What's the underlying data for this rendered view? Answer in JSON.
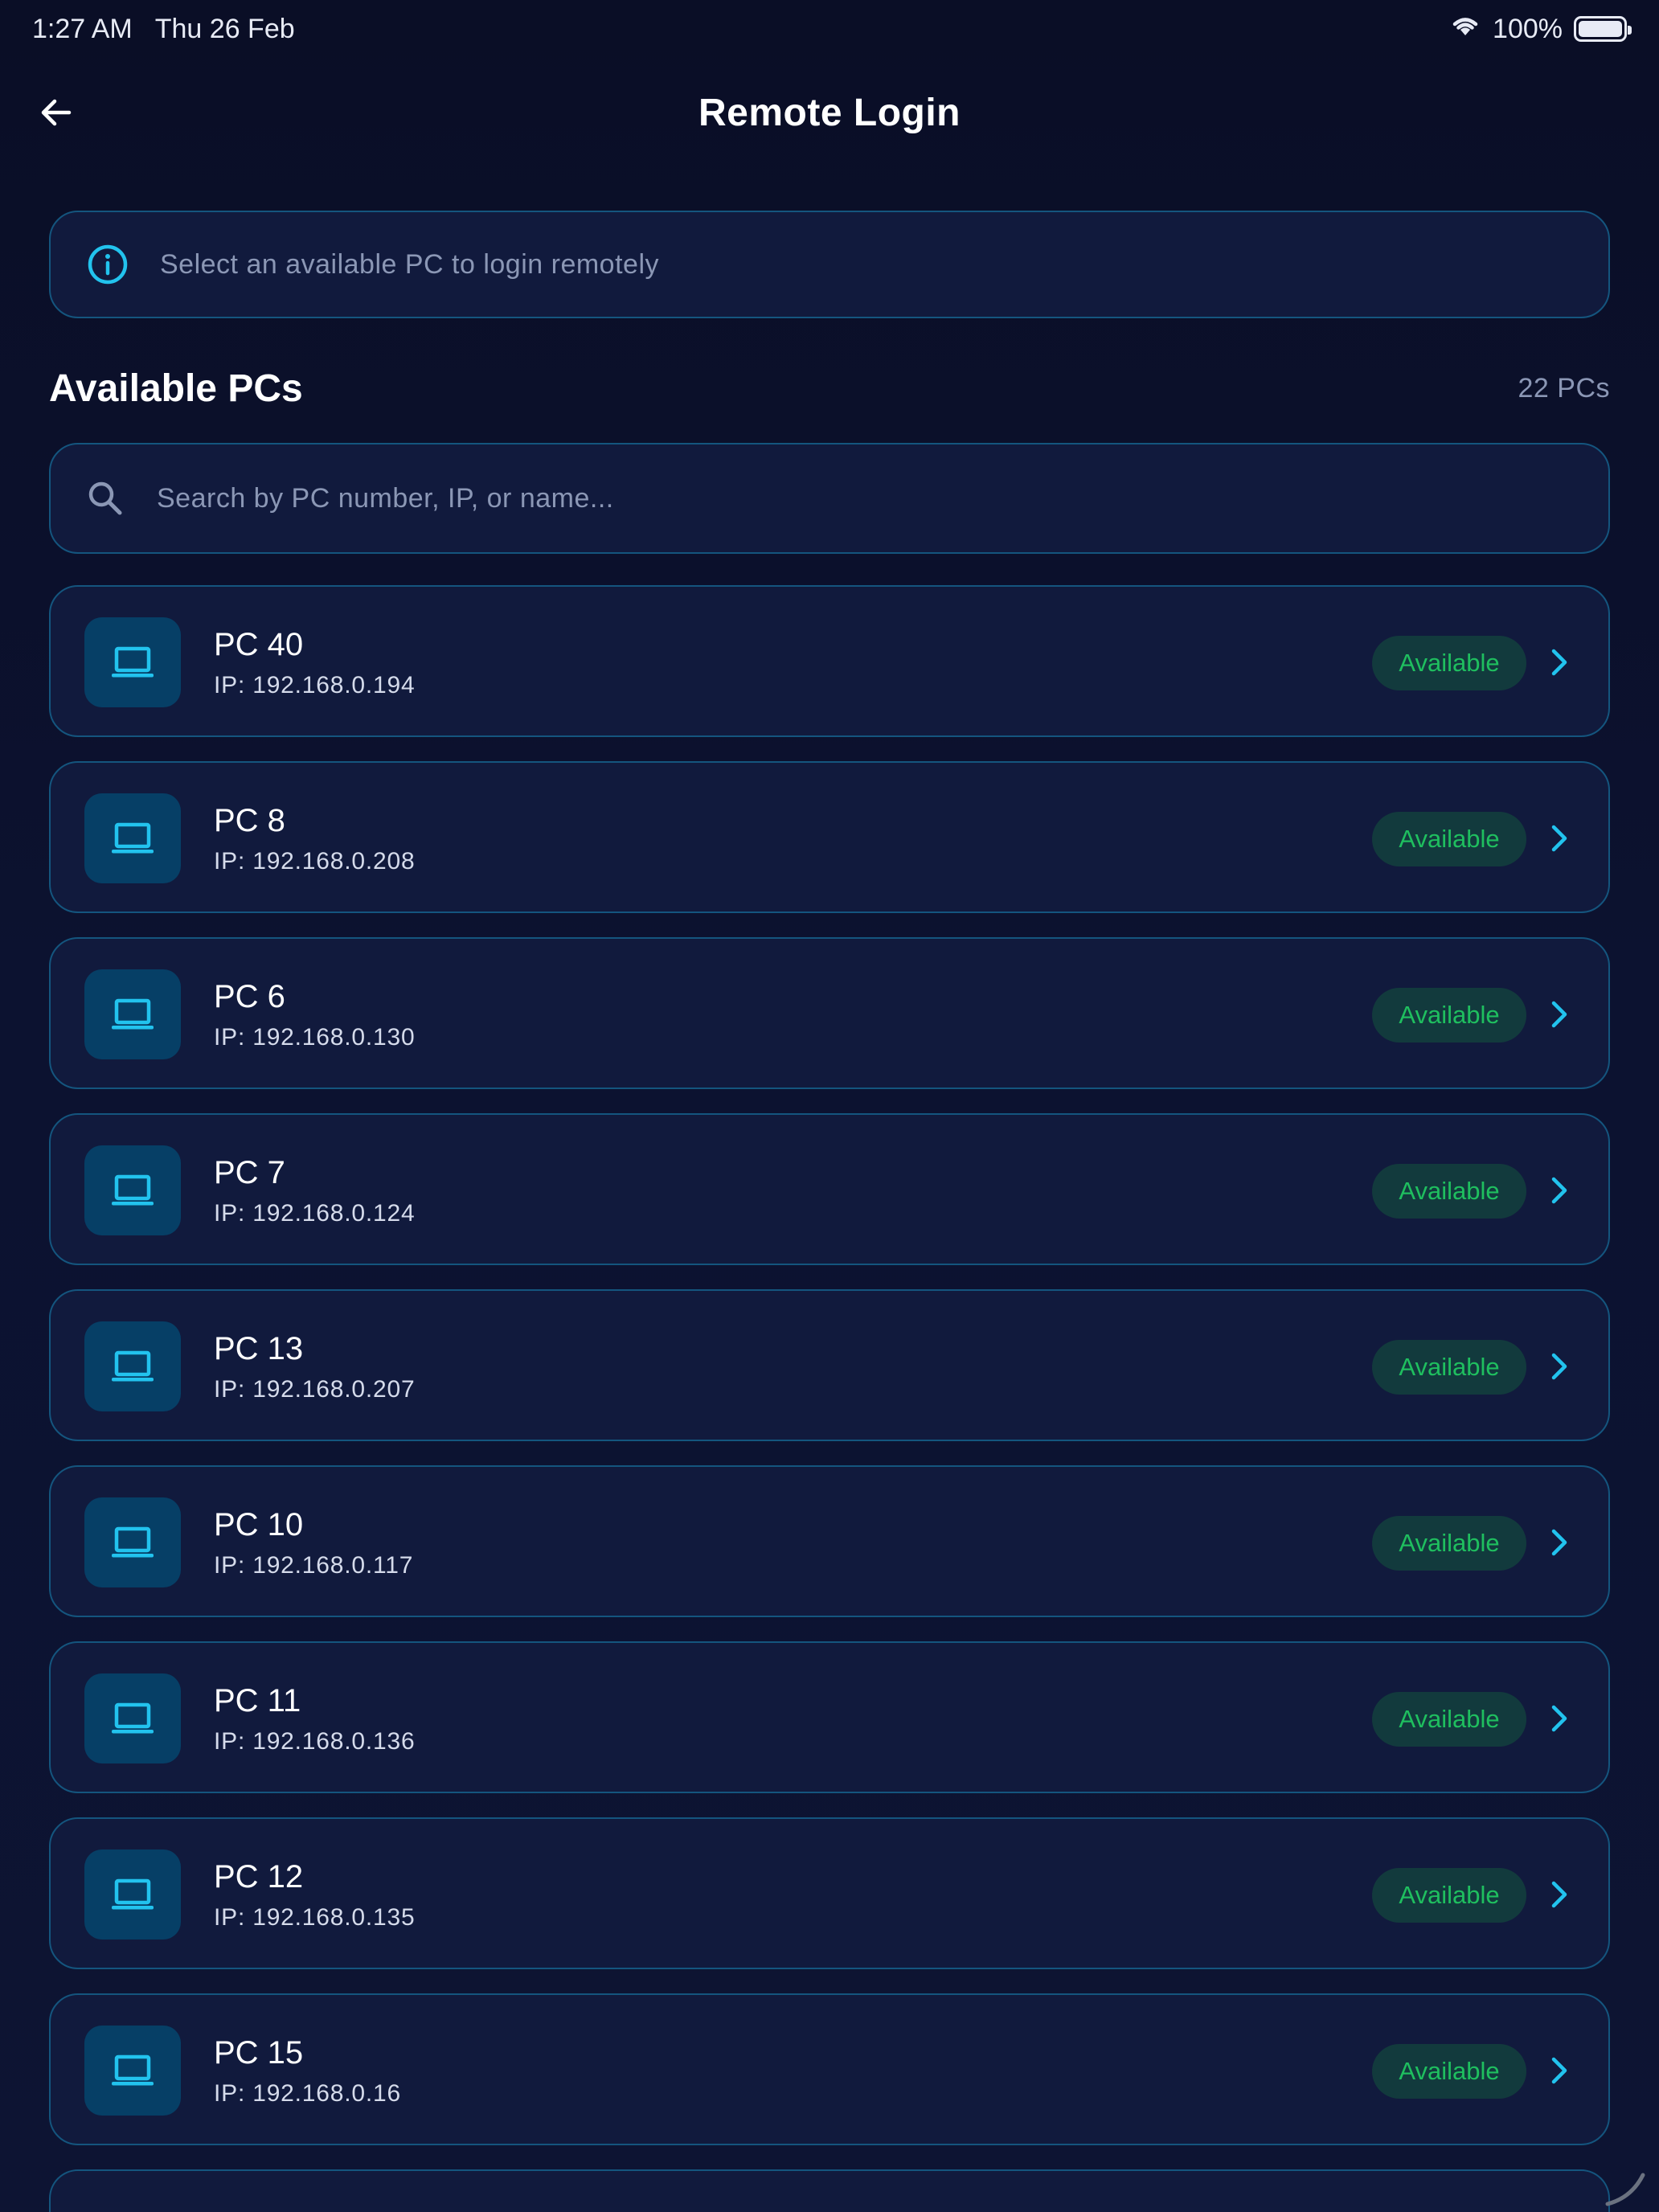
{
  "status_bar": {
    "time": "1:27 AM",
    "date": "Thu 26 Feb",
    "battery": "100%"
  },
  "header": {
    "title": "Remote Login"
  },
  "info_banner": {
    "text": "Select an available PC to login remotely"
  },
  "section": {
    "title": "Available PCs",
    "count": "22 PCs"
  },
  "search": {
    "placeholder": "Search by PC number, IP, or name..."
  },
  "colors": {
    "accent": "#22c3ee",
    "available": "#1fbf5f",
    "background": "#0b1029",
    "card": "#111a3d",
    "border": "#14557e"
  },
  "pcs": [
    {
      "name": "PC 40",
      "ip": "IP: 192.168.0.194",
      "status": "Available"
    },
    {
      "name": "PC 8",
      "ip": "IP: 192.168.0.208",
      "status": "Available"
    },
    {
      "name": "PC 6",
      "ip": "IP: 192.168.0.130",
      "status": "Available"
    },
    {
      "name": "PC 7",
      "ip": "IP: 192.168.0.124",
      "status": "Available"
    },
    {
      "name": "PC 13",
      "ip": "IP: 192.168.0.207",
      "status": "Available"
    },
    {
      "name": "PC 10",
      "ip": "IP: 192.168.0.117",
      "status": "Available"
    },
    {
      "name": "PC 11",
      "ip": "IP: 192.168.0.136",
      "status": "Available"
    },
    {
      "name": "PC 12",
      "ip": "IP: 192.168.0.135",
      "status": "Available"
    },
    {
      "name": "PC 15",
      "ip": "IP: 192.168.0.16",
      "status": "Available"
    }
  ]
}
